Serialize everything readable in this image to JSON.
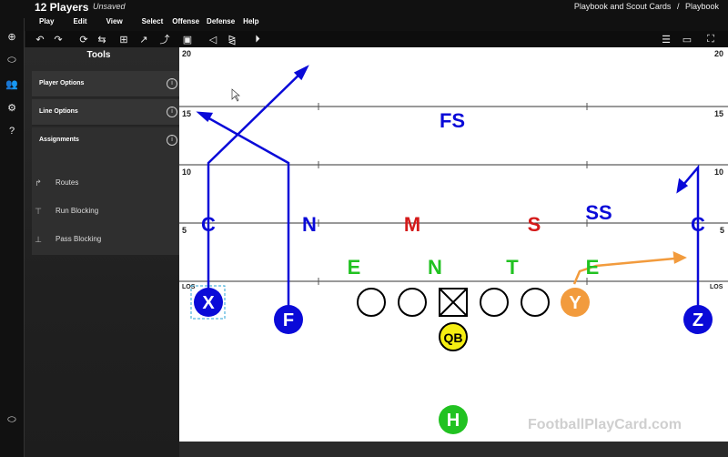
{
  "app": {
    "title": "12 Players",
    "status": "Unsaved"
  },
  "breadcrumb": {
    "first": "Playbook and Scout Cards",
    "sep": "/",
    "second": "Playbook"
  },
  "menu": [
    "Play",
    "Edit",
    "View",
    "Select",
    "Offense",
    "Defense",
    "Help"
  ],
  "tools": {
    "title": "Tools",
    "player_options": "Player Options",
    "line_options": "Line Options",
    "assignments": "Assignments",
    "routes": "Routes",
    "run_blocking": "Run Blocking",
    "pass_blocking": "Pass Blocking",
    "info": "i"
  },
  "field": {
    "yard_labels": [
      "20",
      "15",
      "10",
      "5",
      "LOS"
    ],
    "defense": {
      "fs": "FS",
      "ss": "SS",
      "c_left": "C",
      "c_right": "C",
      "n": "N",
      "m": "M",
      "s": "S",
      "e_left": "E",
      "n_line": "N",
      "t": "T",
      "e_right": "E"
    },
    "offense": {
      "x": "X",
      "f": "F",
      "y": "Y",
      "z": "Z",
      "qb": "QB",
      "h": "H"
    }
  },
  "watermark": "FootballPlayCard.com",
  "colors": {
    "blue": "#0a0ad8",
    "red": "#d41a1a",
    "green": "#21c221",
    "orange": "#f29b3d",
    "yellow": "#f5ee12"
  }
}
